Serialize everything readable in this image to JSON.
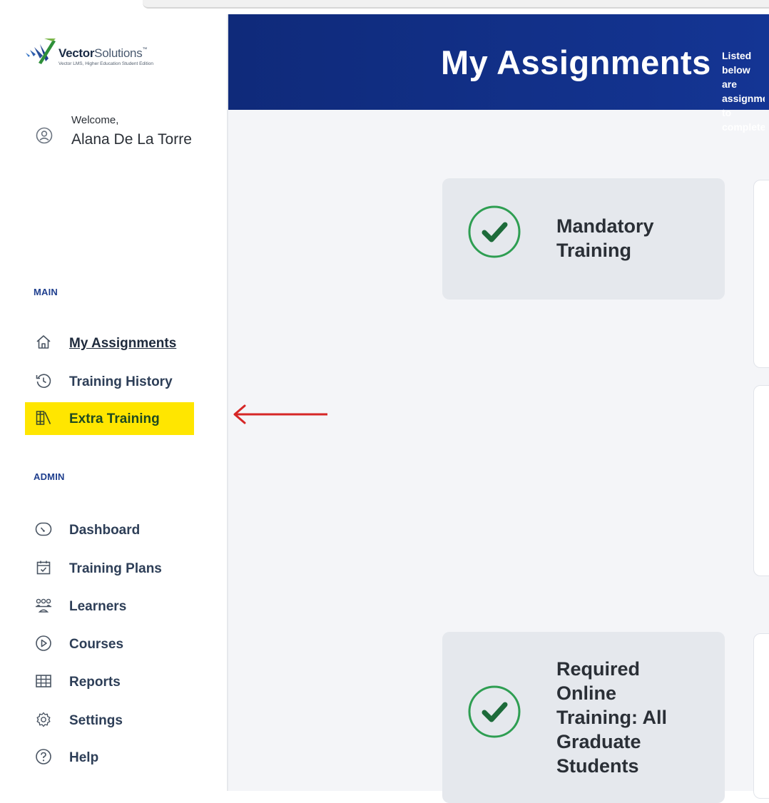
{
  "logo": {
    "brand_bold": "Vector",
    "brand_light": "Solutions",
    "tm": "™",
    "subtitle": "Vector LMS, Higher Education Student Edition"
  },
  "welcome": {
    "label": "Welcome,",
    "name": "Alana De La Torre",
    "icon": "user-circle-icon"
  },
  "sections": {
    "main_label": "MAIN",
    "admin_label": "ADMIN"
  },
  "nav": {
    "main_items": [
      {
        "label": "My Assignments",
        "icon": "home-icon",
        "active": true
      },
      {
        "label": "Training History",
        "icon": "history-icon"
      },
      {
        "label": "Extra Training",
        "icon": "books-icon",
        "highlighted": true
      }
    ],
    "admin_items": [
      {
        "label": "Dashboard",
        "icon": "gauge-icon"
      },
      {
        "label": "Training Plans",
        "icon": "calendar-check-icon"
      },
      {
        "label": "Learners",
        "icon": "people-icon"
      },
      {
        "label": "Courses",
        "icon": "play-circle-icon"
      },
      {
        "label": "Reports",
        "icon": "table-icon"
      },
      {
        "label": "Settings",
        "icon": "gear-icon"
      },
      {
        "label": "Help",
        "icon": "help-icon"
      }
    ]
  },
  "banner": {
    "title": "My Assignments",
    "subtitle": "Listed below are assignments to complete"
  },
  "cards": [
    {
      "title": "Mandatory Training",
      "status": "complete"
    },
    {
      "title": "Required Online Training: All Graduate Students",
      "status": "complete"
    }
  ],
  "colors": {
    "banner": "#12318a",
    "highlight": "#ffe600",
    "check": "#2e9e52",
    "section_label": "#1f3f8e",
    "annotation_arrow": "#d62626"
  }
}
